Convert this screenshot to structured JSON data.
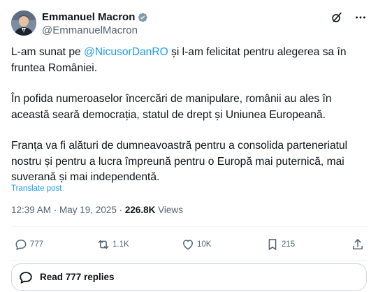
{
  "author": {
    "name": "Emmanuel Macron",
    "handle": "@EmmanuelMacron",
    "verified_color": "#829aab"
  },
  "post": {
    "p1_before": "L-am sunat pe ",
    "p1_mention": "@NicusorDanRO",
    "p1_after": " și l-am felicitat pentru alegerea sa în fruntea României.",
    "p2": "În pofida numeroaselor încercări de manipulare, românii au ales în această seară democrația, statul de drept și Uniunea Europeană.",
    "p3": "Franța va fi alături de dumneavoastră pentru a consolida parteneriatul nostru și pentru a lucra împreună pentru o Europă mai puternică, mai suverană și mai independentă."
  },
  "translate_label": "Translate post",
  "meta": {
    "time": "12:39 AM",
    "sep": " · ",
    "date": "May 19, 2025",
    "views_count": "226.8K",
    "views_label": " Views"
  },
  "actions": {
    "replies": "777",
    "reposts": "1.1K",
    "likes": "10K",
    "bookmarks": "215"
  },
  "read_replies_label": "Read 777 replies",
  "icons": [
    "grok-icon",
    "more-icon",
    "reply-icon",
    "repost-icon",
    "like-icon",
    "bookmark-icon",
    "share-icon",
    "speech-bubble-icon"
  ],
  "colors": {
    "link": "#1d9bf0",
    "muted": "#536471",
    "text": "#0f1419"
  }
}
